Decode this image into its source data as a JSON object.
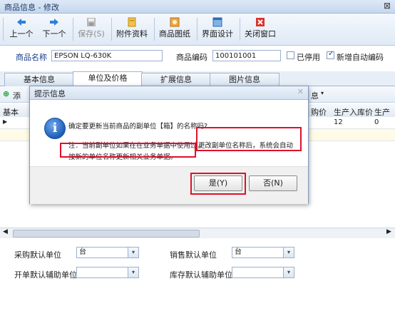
{
  "window": {
    "title": "商品信息 - 修改",
    "close_glyph": "ΣЗ"
  },
  "toolbar": [
    {
      "label": "上一个",
      "icon": "arrow-left-icon",
      "enabled": true
    },
    {
      "label": "下一个",
      "icon": "arrow-right-icon",
      "enabled": true
    },
    {
      "label": "保存(S)",
      "icon": "save-icon",
      "enabled": false
    },
    {
      "label": "附件资料",
      "icon": "attachment-icon",
      "enabled": true
    },
    {
      "label": "商品图纸",
      "icon": "drawing-icon",
      "enabled": true
    },
    {
      "label": "界面设计",
      "icon": "layout-icon",
      "enabled": true
    },
    {
      "label": "关闭窗口",
      "icon": "close-window-icon",
      "enabled": true
    }
  ],
  "product": {
    "name_label": "商品名称",
    "name_value": "EPSON LQ-630K",
    "code_label": "商品编码",
    "code_value": "100101001",
    "disabled_label": "已停用",
    "disabled_checked": false,
    "auto_code_label": "新增自动编码",
    "auto_code_checked": true
  },
  "tabs": [
    "基本信息",
    "单位及价格",
    "扩展信息",
    "图片信息"
  ],
  "active_tab": 1,
  "subtoolbar": {
    "add_label": "添",
    "extra_label": "息"
  },
  "grid": {
    "header_left": "基本",
    "header_right": [
      "购价",
      "生产入库价",
      "生产入"
    ],
    "row1_right": [
      "12",
      "0"
    ]
  },
  "bottom_form": {
    "purchase_unit_label": "采购默认单位",
    "purchase_unit_value": "台",
    "sales_unit_label": "销售默认单位",
    "sales_unit_value": "台",
    "billing_aux_label": "开单默认辅助单位",
    "billing_aux_value": "",
    "stock_aux_label": "库存默认辅助单位",
    "stock_aux_value": ""
  },
  "dialog": {
    "title": "提示信息",
    "question": "确定要更新当前商品的副单位【箱】的名称吗?",
    "note_part1": "注：当前副单位如果在在业务单据中使用过，",
    "note_part2": "更改副单位名称后，系统会自动",
    "note_part3": "按新的单位名称更新相关业务单据。",
    "yes_label": "是(Y)",
    "no_label": "否(N)",
    "highlight_color": "#e0102a"
  }
}
